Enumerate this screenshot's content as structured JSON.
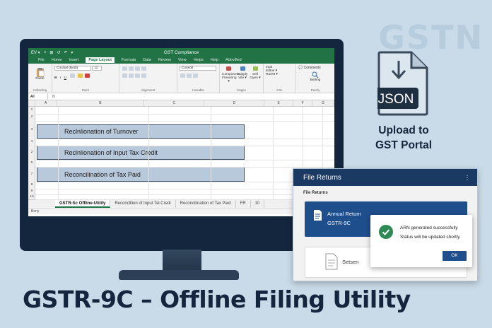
{
  "watermark": "GSTN",
  "excel": {
    "title": "GST Compliance",
    "quick_access": [
      "EV ▾",
      "⌂",
      "⊞",
      "↺",
      "↶",
      "▾"
    ],
    "tabs": [
      "File",
      "Home",
      "Insert",
      "Page Layout",
      "Formula",
      "Data",
      "Review",
      "View",
      "Helps",
      "Help",
      "Adovified"
    ],
    "active_tab": "Page Layout",
    "comments_label": "Comments",
    "ribbon": {
      "clipboard": "Collecting",
      "paste": "Paste",
      "font_group": "Pack",
      "font_name": "Cocibal (Bodi)",
      "font_size": "11",
      "alignment_group": "Alignment",
      "number_group": "Heoable",
      "number_format": "Consoll",
      "styles_group": "Suges",
      "styles_items": [
        "Component Freeuring ▾",
        "Supply Vile ▾",
        "Sell Oyen ▾"
      ],
      "cells_group": "CXL",
      "cells_items": [
        "Inpit",
        "Edtos ▾",
        "Rurett ▾"
      ],
      "editing_group": "Peerly",
      "editing_label": "Betling"
    },
    "name_box": "All",
    "formula_fx": "fx",
    "columns": [
      "A",
      "B",
      "C",
      "D",
      "E",
      "F",
      "G"
    ],
    "rows": [
      "1",
      "2",
      "3",
      "4",
      "2",
      "6",
      "7",
      "8",
      "9",
      "10"
    ],
    "bands": [
      "Reclnlionation of Turnover",
      "Reclnlionation of Input Tax Credit",
      "Reconcilination of Tax Paid"
    ],
    "sheet_tabs": [
      "GSTR-Sc Offline-Utility",
      "Reconclllion of Input Tal Credi",
      "Reconcilination of Tax Paid",
      "FR",
      "10"
    ],
    "status": "Beny"
  },
  "upload": {
    "file_label": "JSON",
    "line1": "Upload to",
    "line2": "GST Portal"
  },
  "file_returns": {
    "title": "File Returns",
    "menu_icon": "⋮",
    "subtitle": "File Returns",
    "card1_line1": "Annual Return",
    "card1_line2": "GSTR-9C",
    "card2_label": "Setsen"
  },
  "dialog": {
    "msg1": "ARN generated successfully",
    "msg2": "Status will be updated shortly",
    "ok": "OK"
  },
  "headline": "GSTR-9C – Offline Filing Utility",
  "colors": {
    "excel_green": "#217346",
    "navy": "#14263d",
    "band_blue": "#b8c9dc",
    "card_blue": "#1f4e8c",
    "success": "#2e8a55"
  }
}
